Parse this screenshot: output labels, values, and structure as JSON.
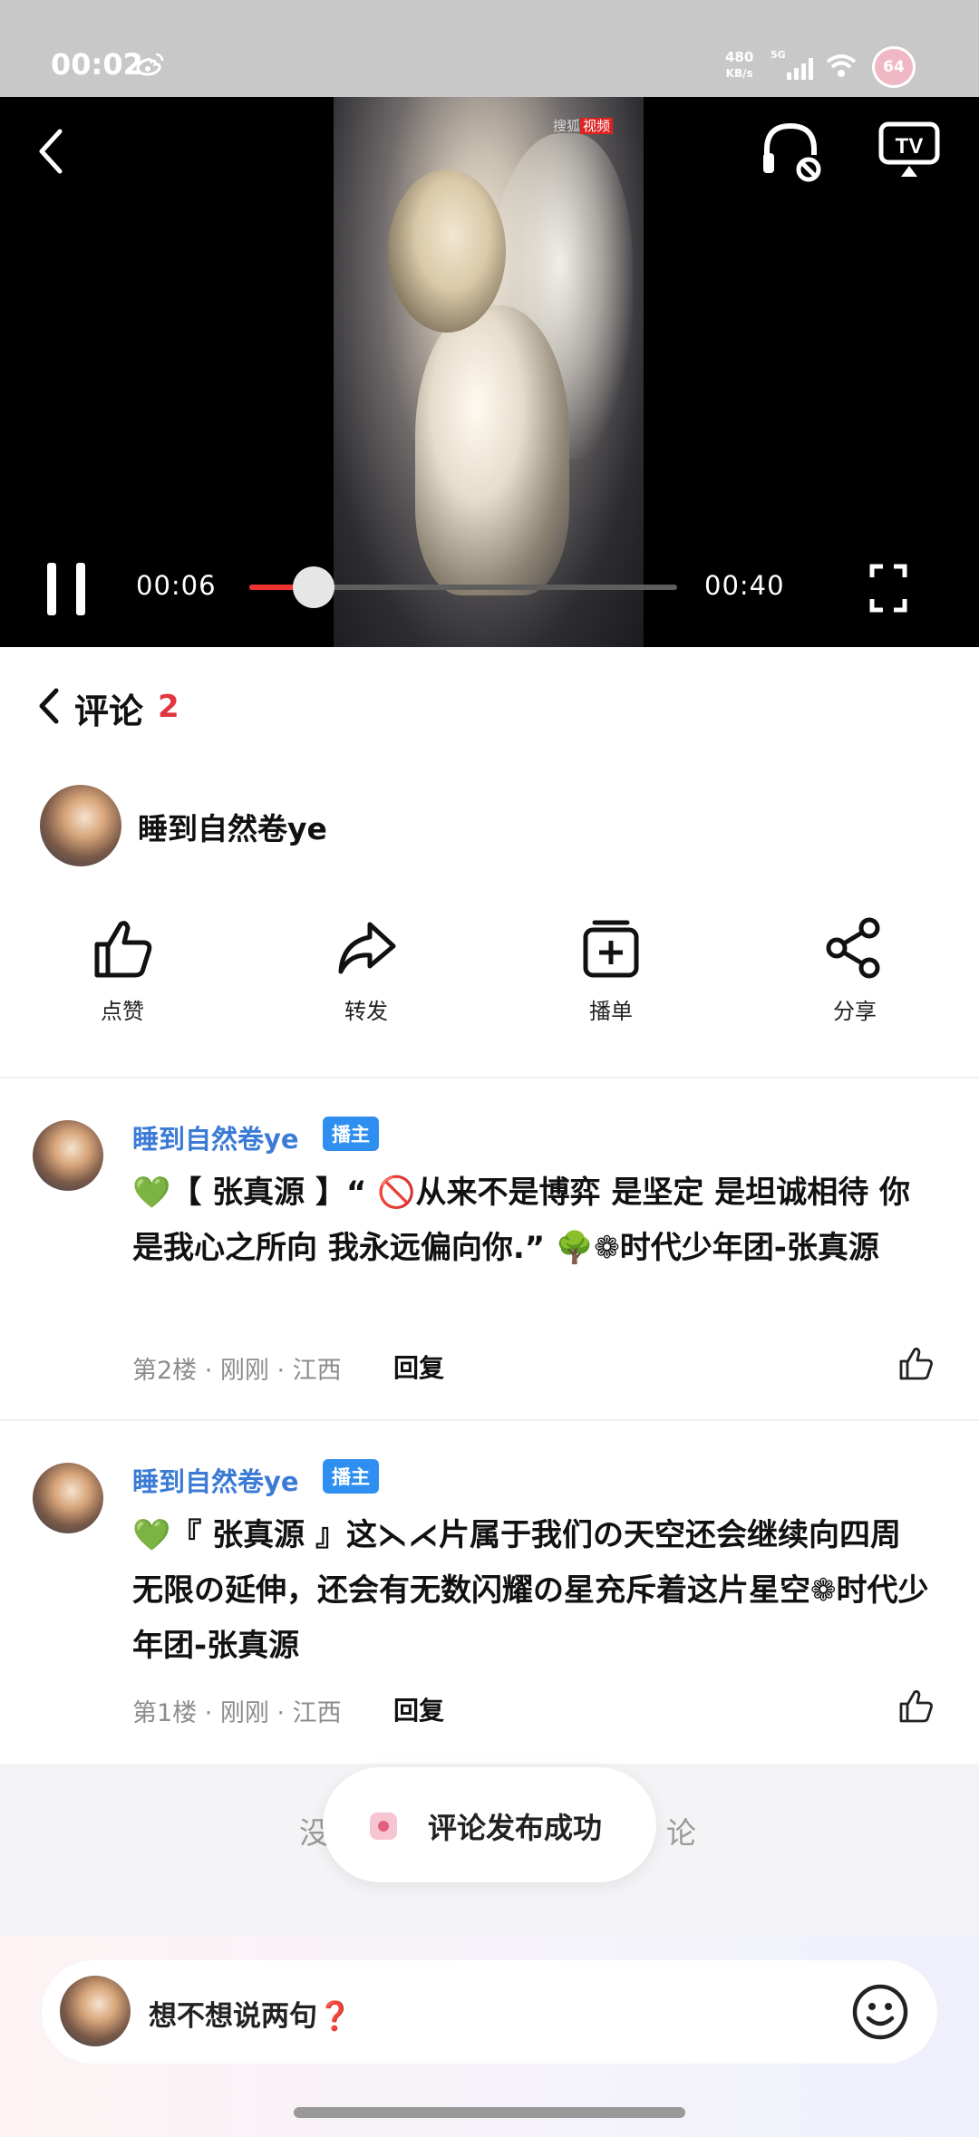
{
  "status_bar": {
    "time": "00:02",
    "net_speed_value": "480",
    "net_speed_unit": "KB/s",
    "network": "5G",
    "battery": "64"
  },
  "video": {
    "watermark_brand": "搜狐",
    "watermark_tag": "视频",
    "current_time": "00:06",
    "total_time": "00:40",
    "progress": 0.15
  },
  "comments_header": {
    "title": "评论",
    "count": "2"
  },
  "author": {
    "name": "睡到自然卷ye"
  },
  "actions": [
    {
      "label": "点赞",
      "icon": "thumbs-up-icon"
    },
    {
      "label": "转发",
      "icon": "forward-arrow-icon"
    },
    {
      "label": "播单",
      "icon": "add-playlist-icon"
    },
    {
      "label": "分享",
      "icon": "share-icon"
    }
  ],
  "comments": [
    {
      "name": "睡到自然卷ye",
      "badge": "播主",
      "text": "💚【 张真源 】“ 🚫从来不是博弈 是坚定 是坦诚相待 你是我心之所向 我永远偏向你.” 🌳❁时代少年团-张真源",
      "meta": "第2楼 · 刚刚 · 江西",
      "reply": "回复"
    },
    {
      "name": "睡到自然卷ye",
      "badge": "播主",
      "text": "💚『 张真源 』这⋋⋌片属于我们の天空还会继续向四周无限の延伸，还会有无数闪耀の星充斥着这片星空❁时代少年团-张真源",
      "meta": "第1楼 · 刚刚 · 江西",
      "reply": "回复"
    }
  ],
  "empty_hint_left": "没",
  "empty_hint_right": "论",
  "toast": {
    "text": "评论发布成功"
  },
  "input": {
    "placeholder": "想不想说两句❓"
  },
  "colors": {
    "accent_red": "#e1353f",
    "name_blue": "#3b7bd6",
    "badge_blue": "#2f8ff0"
  }
}
